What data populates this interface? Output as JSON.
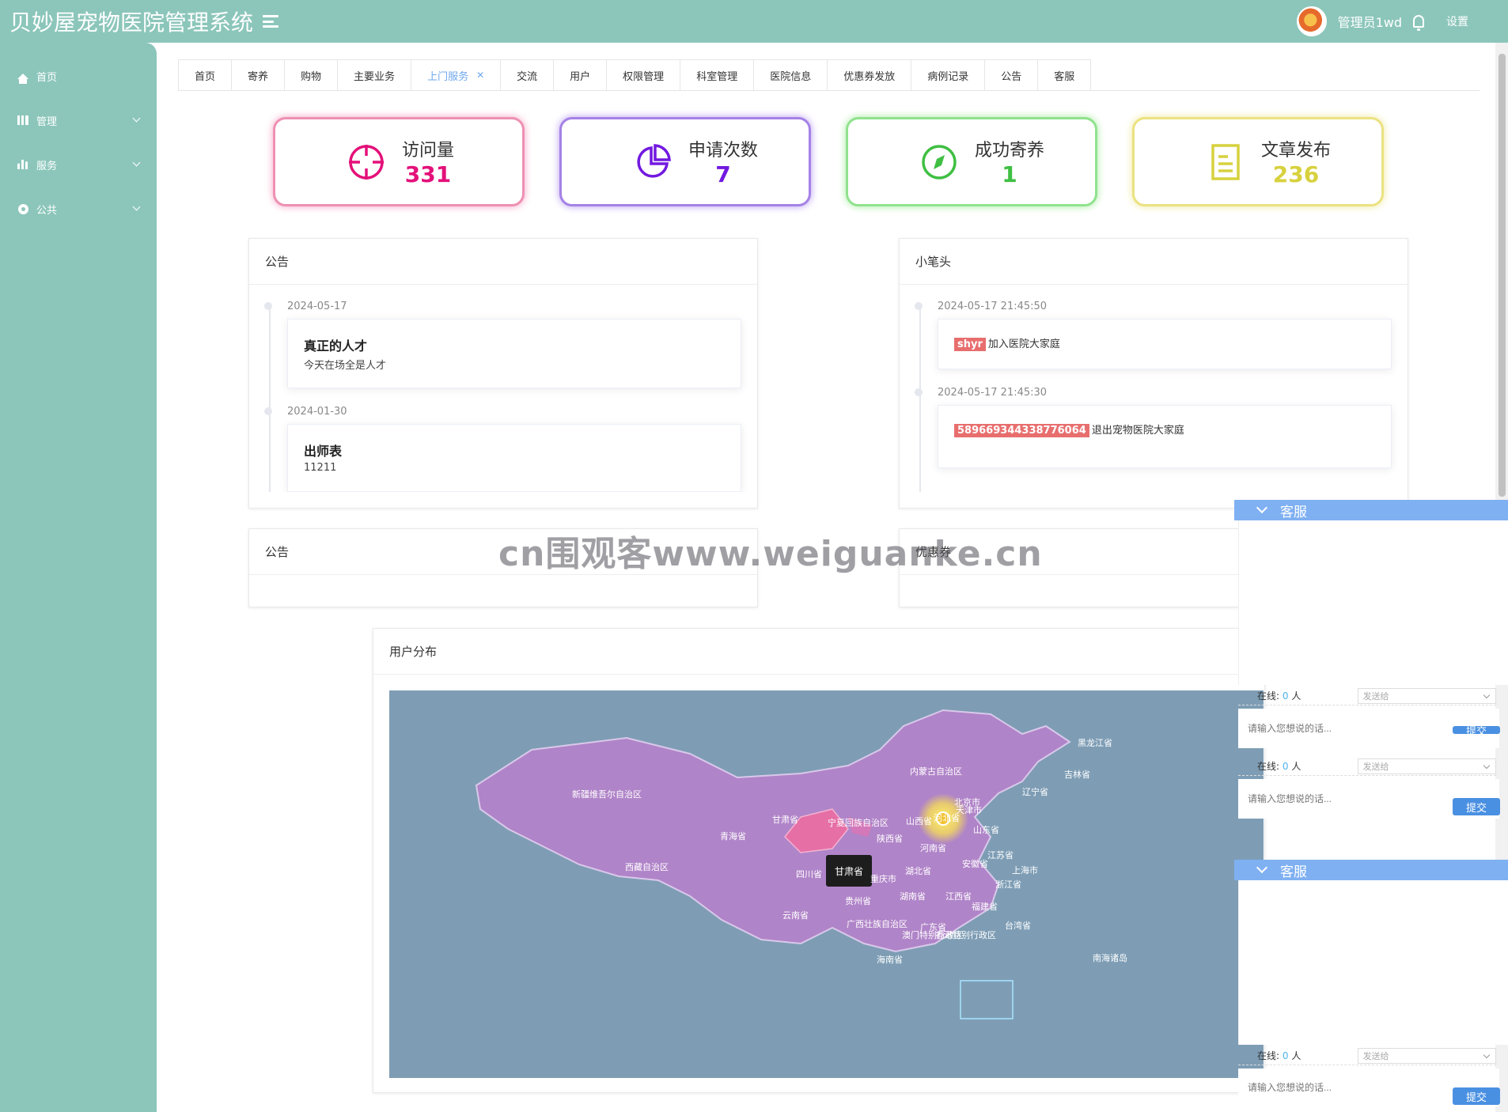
{
  "header": {
    "title": "贝妙屋宠物医院管理系统",
    "user": "管理员1wd",
    "settings": "设置"
  },
  "sidebar": {
    "items": [
      {
        "label": "首页",
        "icon": "home-icon"
      },
      {
        "label": "管理",
        "icon": "grid-icon"
      },
      {
        "label": "服务",
        "icon": "bar-chart-icon"
      },
      {
        "label": "公共",
        "icon": "gear-icon"
      }
    ]
  },
  "tabs": [
    {
      "label": "首页"
    },
    {
      "label": "寄养"
    },
    {
      "label": "购物"
    },
    {
      "label": "主要业务"
    },
    {
      "label": "上门服务",
      "active": true
    },
    {
      "label": "交流"
    },
    {
      "label": "用户"
    },
    {
      "label": "权限管理"
    },
    {
      "label": "科室管理"
    },
    {
      "label": "医院信息"
    },
    {
      "label": "优惠券发放"
    },
    {
      "label": "病例记录"
    },
    {
      "label": "公告"
    },
    {
      "label": "客服"
    }
  ],
  "stats": [
    {
      "label": "访问量",
      "value": "331",
      "color": "#e4117a"
    },
    {
      "label": "申请次数",
      "value": "7",
      "color": "#7219e0"
    },
    {
      "label": "成功寄养",
      "value": "1",
      "color": "#3fbf42"
    },
    {
      "label": "文章发布",
      "value": "236",
      "color": "#d7d13e"
    }
  ],
  "notice_panel": {
    "title": "公告",
    "items": [
      {
        "date": "2024-05-17",
        "title": "真正的人才",
        "body": "今天在场全是人才"
      },
      {
        "date": "2024-01-30",
        "title": "出师表",
        "body": "11211"
      }
    ]
  },
  "pen_panel": {
    "title": "小笔头",
    "items": [
      {
        "date": "2024-05-17 21:45:50",
        "tag": "shyr",
        "text": "加入医院大家庭"
      },
      {
        "date": "2024-05-17 21:45:30",
        "tag": "589669344338776064",
        "text": "退出宠物医院大家庭"
      }
    ]
  },
  "notice_panel_2": {
    "title": "公告"
  },
  "coupon_panel": {
    "title": "优惠券"
  },
  "map_panel": {
    "title": "用户分布",
    "tooltip": "甘肃省",
    "provinces": [
      "黑龙江省",
      "吉林省",
      "辽宁省",
      "内蒙古自治区",
      "北京市",
      "天津市",
      "河北省",
      "山西省",
      "山东省",
      "河南省",
      "新疆维吾尔自治区",
      "甘肃省",
      "宁夏回族自治区",
      "陕西省",
      "青海省",
      "西藏自治区",
      "四川省",
      "重庆市",
      "湖北省",
      "安徽省",
      "江苏省",
      "上海市",
      "浙江省",
      "湖南省",
      "江西省",
      "贵州省",
      "云南省",
      "广西壮族自治区",
      "广东省",
      "福建省",
      "台湾省",
      "海南省",
      "澳门特别行政区",
      "香港特别行政区",
      "南海诸岛"
    ]
  },
  "watermark": "cn围观客www.weiguanke.cn",
  "chat": {
    "title": "客服",
    "online_label": "在线:",
    "online_count": "0",
    "online_unit": "人",
    "send_to": "发送给",
    "placeholder": "请输入您想说的话...",
    "submit": "提交"
  }
}
